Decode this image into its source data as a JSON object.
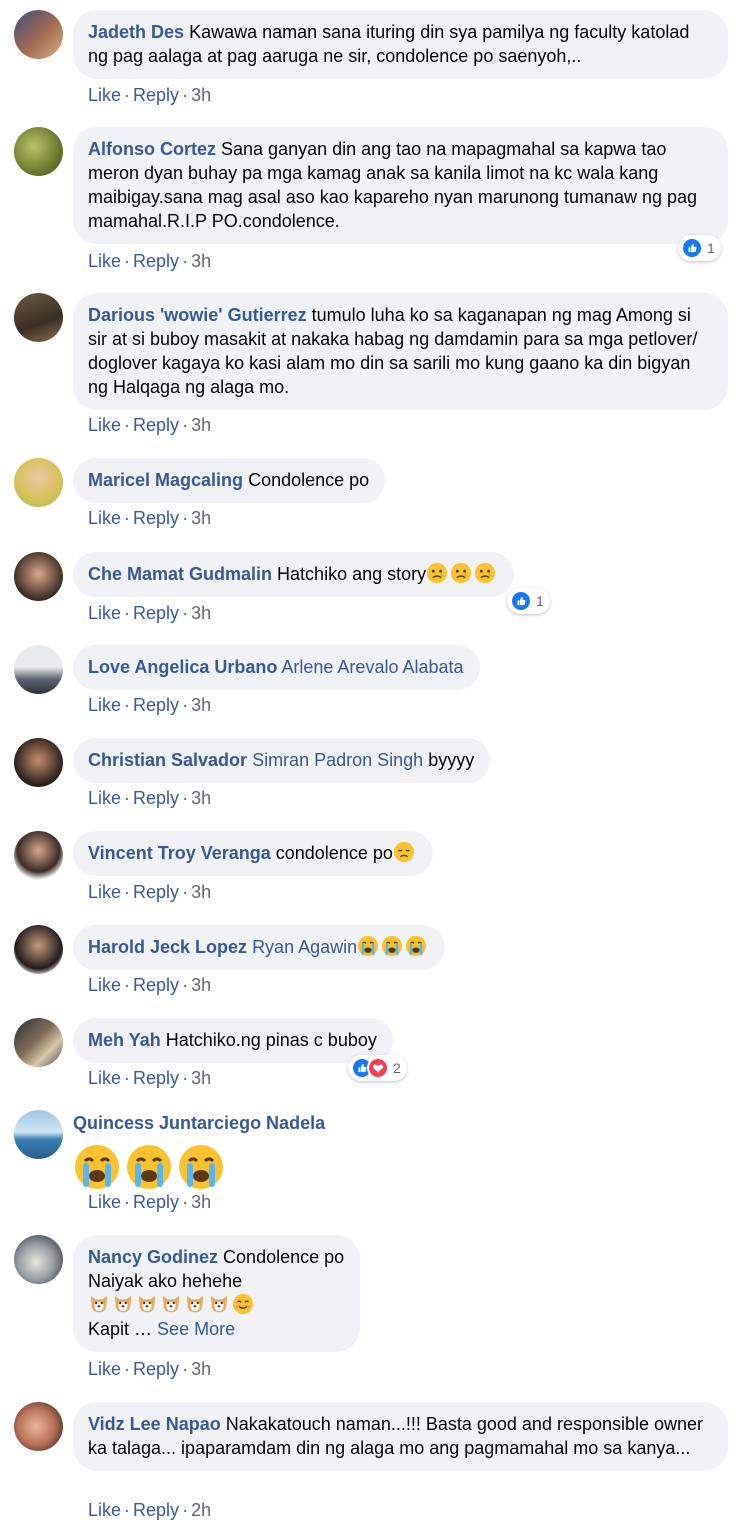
{
  "actions": {
    "like": "Like",
    "reply": "Reply",
    "sep": "·"
  },
  "colors": {
    "name_link": "#385898",
    "bubble_bg": "#f0f2f5",
    "like_blue": "#1877f2",
    "love_red": "#f33e58"
  },
  "comments": [
    {
      "name": "Jadeth Des",
      "text": "Kawawa naman sana ituring din sya pamilya ng faculty katolad ng pag aalaga at pag aaruga ne sir, condolence po saenyoh,..",
      "time": "3h"
    },
    {
      "name": "Alfonso Cortez",
      "text": "Sana ganyan din ang tao na mapagmahal sa kapwa tao meron dyan buhay pa mga kamag anak sa kanila limot na kc wala kang maibigay.sana mag asal aso kao kapareho nyan marunong tumanaw ng pag mamahal.R.I.P PO.condolence.",
      "time": "3h",
      "reactions": {
        "types": [
          "like"
        ],
        "count": "1"
      }
    },
    {
      "name": "Darious 'wowie' Gutierrez",
      "text": "tumulo luha ko sa kaganapan ng mag Among si sir at si buboy masakit at nakaka habag ng damdamin para sa mga petlover/ doglover kagaya ko kasi alam mo din sa sarili mo kung gaano ka din bigyan ng Halqaga ng alaga mo.",
      "time": "3h"
    },
    {
      "name": "Maricel Magcaling",
      "text": "Condolence po",
      "time": "3h"
    },
    {
      "name": "Che Mamat Gudmalin",
      "text": "Hatchiko ang story",
      "emojis": [
        "sad-tear-emoji",
        "sad-tear-emoji",
        "sad-tear-emoji"
      ],
      "time": "3h",
      "reactions": {
        "types": [
          "like"
        ],
        "count": "1"
      }
    },
    {
      "name": "Love Angelica Urbano",
      "tag": "Arlene Arevalo Alabata",
      "text": "",
      "time": "3h"
    },
    {
      "name": "Christian Salvador",
      "tag": "Simran Padron Singh",
      "text": "byyyy",
      "time": "3h"
    },
    {
      "name": "Vincent Troy Veranga",
      "text": "condolence po",
      "emojis": [
        "disappointed-emoji"
      ],
      "time": "3h"
    },
    {
      "name": "Harold Jeck Lopez",
      "tag": "Ryan Agawin",
      "text": "",
      "emojis": [
        "crying-emoji",
        "crying-emoji",
        "crying-emoji"
      ],
      "time": "3h"
    },
    {
      "name": "Meh Yah",
      "text": "Hatchiko.ng pinas c buboy",
      "time": "3h",
      "reactions": {
        "types": [
          "like",
          "love"
        ],
        "count": "2"
      }
    },
    {
      "name": "Quincess Juntarciego Nadela",
      "big_emojis": [
        "crying-emoji",
        "crying-emoji",
        "crying-emoji"
      ],
      "time": "3h"
    },
    {
      "name": "Nancy Godinez",
      "text": "Condolence po",
      "line2": "Naiyak ako hehehe",
      "emojis": [
        "dog-face-emoji",
        "dog-face-emoji",
        "dog-face-emoji",
        "dog-face-emoji",
        "dog-face-emoji",
        "dog-face-emoji",
        "smiling-emoji"
      ],
      "line4": "Kapit …",
      "see_more": "See More",
      "time": "3h"
    },
    {
      "name": "Vidz Lee Napao",
      "text": "Nakakatouch naman...!!! Basta good and responsible owner ka talaga... ipaparamdam din ng alaga mo ang pagmamahal mo sa kanya...",
      "time": "2h"
    }
  ]
}
